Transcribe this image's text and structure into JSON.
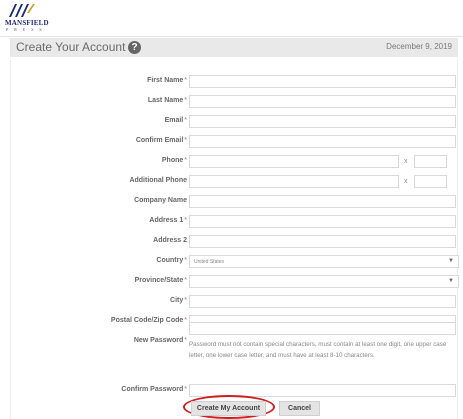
{
  "brand": {
    "logo_text": "MANSFIELD",
    "logo_sub": "P R E S S"
  },
  "header": {
    "title": "Create Your Account",
    "help_glyph": "?",
    "date": "December 9, 2019"
  },
  "form": {
    "required_mark": "*",
    "ext_sep": "x",
    "labels": {
      "first_name": "First Name",
      "last_name": "Last Name",
      "email": "Email",
      "confirm_email": "Confirm Email",
      "phone": "Phone",
      "additional_phone": "Additional Phone",
      "company_name": "Company Name",
      "address1": "Address 1",
      "address2": "Address 2",
      "country": "Country",
      "province": "Province/State",
      "city": "City",
      "postal": "Postal Code/Zip Code",
      "new_password": "New Password",
      "confirm_password": "Confirm Password"
    },
    "country_value": "United States",
    "province_value": "",
    "password_note": "Password must not contain special characters, must contain at least one digit, one upper case letter, one lower case letter, and must have at least 8-10 characters.",
    "buttons": {
      "create": "Create My Account",
      "cancel": "Cancel"
    }
  },
  "colors": {
    "required": "#e06060",
    "highlight_circle": "#cc1f1f",
    "header_bg": "#e9e9e9"
  },
  "icons": {
    "help": "help-circle-icon",
    "dropdown": "chevron-down-icon"
  }
}
